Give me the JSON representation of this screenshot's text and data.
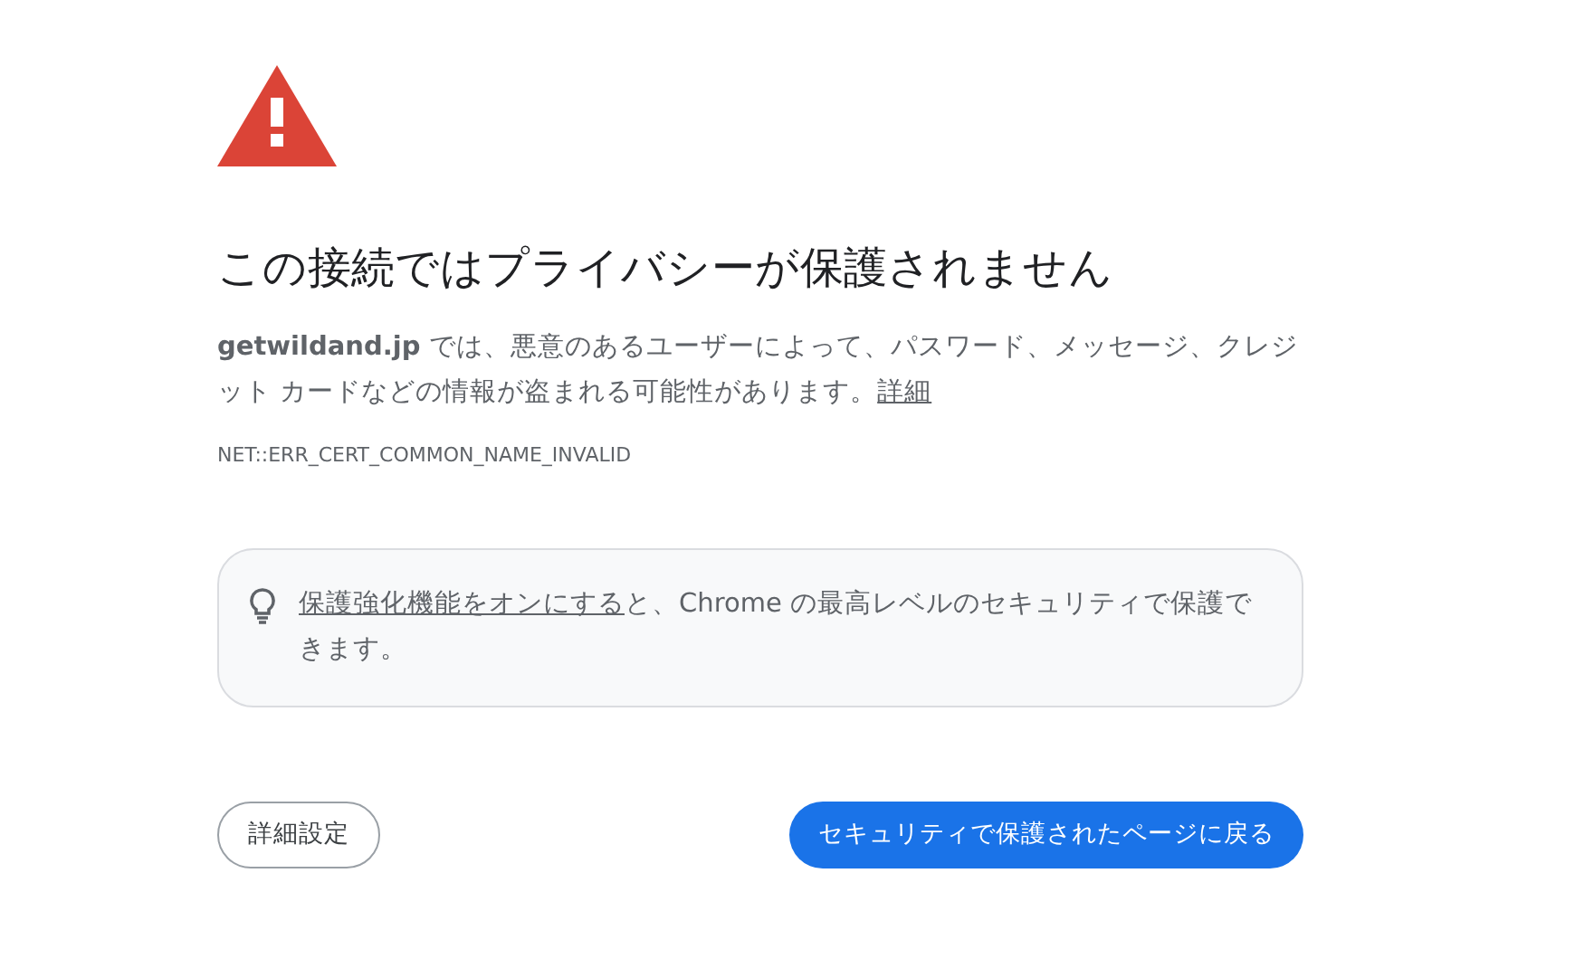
{
  "heading": "この接続ではプライバシーが保護されません",
  "description": {
    "text": "**getwildand.jp** では、悪意のあるユーザーによって、パスワード、メッセージ、クレジット カードなどの情報が盗まれる可能性があります。",
    "link": "詳細"
  },
  "error_code": "NET::ERR_CERT_COMMON_NAME_INVALID",
  "tip": {
    "link": "保護強化機能をオンにする",
    "text": "と、Chrome の最高レベルのセキュリティで保護できます。"
  },
  "buttons": [
    {
      "label": "詳細設定",
      "kind": "secondary"
    },
    {
      "label": "セキュリティで保護されたページに戻る",
      "kind": "primary"
    }
  ]
}
